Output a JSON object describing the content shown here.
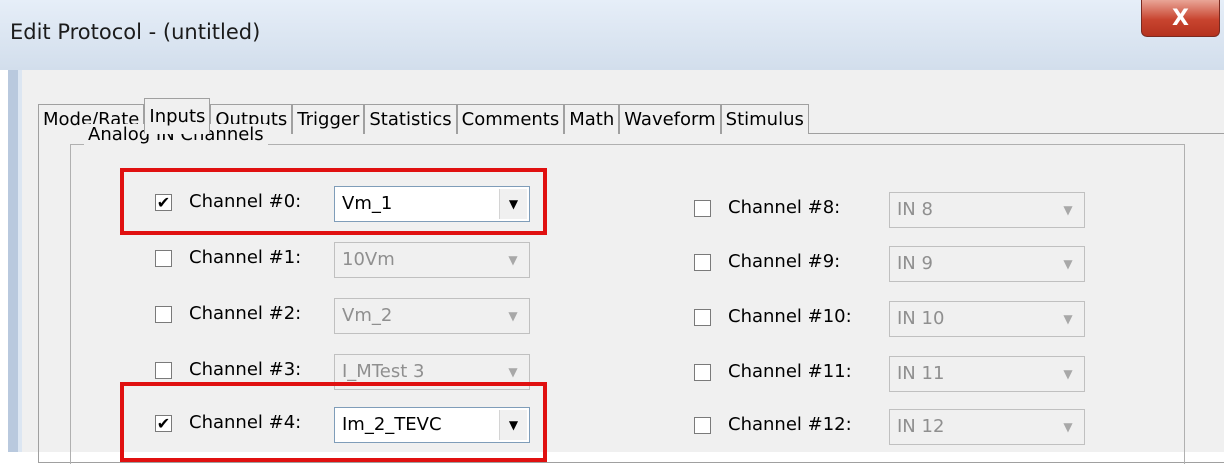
{
  "window": {
    "title": "Edit Protocol - (untitled)",
    "close_glyph": "X"
  },
  "tabs": [
    "Mode/Rate",
    "Inputs",
    "Outputs",
    "Trigger",
    "Statistics",
    "Comments",
    "Math",
    "Waveform",
    "Stimulus"
  ],
  "selected_tab": "Inputs",
  "group": {
    "label": "Analog IN Channels"
  },
  "channels_left": [
    {
      "label": "Channel #0:",
      "checked": true,
      "check": "✔",
      "value": "Vm_1",
      "enabled": true
    },
    {
      "label": "Channel #1:",
      "checked": false,
      "check": "",
      "value": "10Vm",
      "enabled": false
    },
    {
      "label": "Channel #2:",
      "checked": false,
      "check": "",
      "value": "Vm_2",
      "enabled": false
    },
    {
      "label": "Channel #3:",
      "checked": false,
      "check": "",
      "value": "I_MTest 3",
      "enabled": false
    },
    {
      "label": "Channel #4:",
      "checked": true,
      "check": "✔",
      "value": "Im_2_TEVC",
      "enabled": true
    }
  ],
  "channels_right": [
    {
      "label": "Channel #8:",
      "checked": false,
      "check": "",
      "value": "IN 8",
      "enabled": false
    },
    {
      "label": "Channel #9:",
      "checked": false,
      "check": "",
      "value": "IN 9",
      "enabled": false
    },
    {
      "label": "Channel #10:",
      "checked": false,
      "check": "",
      "value": "IN 10",
      "enabled": false
    },
    {
      "label": "Channel #11:",
      "checked": false,
      "check": "",
      "value": "IN 11",
      "enabled": false
    },
    {
      "label": "Channel #12:",
      "checked": false,
      "check": "",
      "value": "IN 12",
      "enabled": false
    }
  ],
  "colors": {
    "highlight": "#e01010",
    "titlebar": "#dce6f2",
    "close": "#c8442f"
  }
}
